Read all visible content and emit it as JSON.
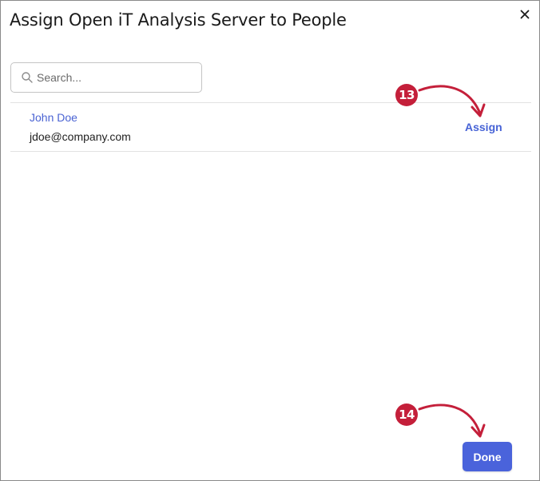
{
  "dialog": {
    "title": "Assign Open iT Analysis Server to People",
    "close_icon": "close-icon"
  },
  "search": {
    "placeholder": "Search...",
    "value": "",
    "icon": "search-icon"
  },
  "people": [
    {
      "name": "John Doe",
      "email": "jdoe@company.com",
      "action_label": "Assign"
    }
  ],
  "footer": {
    "done_label": "Done"
  },
  "annotations": [
    {
      "number": "13",
      "color": "#c41f3a"
    },
    {
      "number": "14",
      "color": "#c41f3a"
    }
  ],
  "colors": {
    "accent": "#4a63db",
    "link": "#4a63d3",
    "annotation": "#c41f3a"
  }
}
